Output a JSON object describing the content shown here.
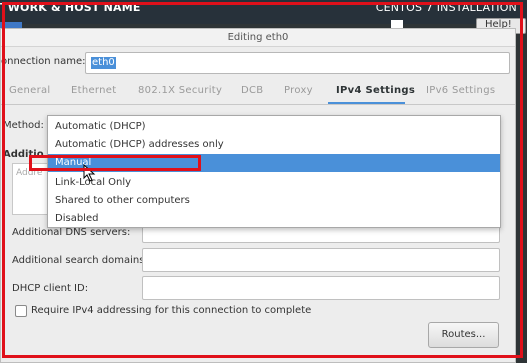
{
  "topbar": {
    "title": "TWORK & HOST NAME",
    "installer": "CENTOS 7 INSTALLATION",
    "help_label": "Help!"
  },
  "dialog": {
    "title": "Editing eth0",
    "connection_name_label": "onnection name:",
    "connection_name_value": "eth0"
  },
  "tabs": [
    {
      "label": "General",
      "active": false
    },
    {
      "label": "Ethernet",
      "active": false
    },
    {
      "label": "802.1X Security",
      "active": false
    },
    {
      "label": "DCB",
      "active": false
    },
    {
      "label": "Proxy",
      "active": false
    },
    {
      "label": "IPv4 Settings",
      "active": true
    },
    {
      "label": "IPv6 Settings",
      "active": false
    }
  ],
  "method": {
    "label": "Method:",
    "options": [
      "Automatic (DHCP)",
      "Automatic (DHCP) addresses only",
      "Manual",
      "Link-Local Only",
      "Shared to other computers",
      "Disabled"
    ],
    "highlighted_index": 2
  },
  "addresses": {
    "section_label": "Additio",
    "column_header": "Addre"
  },
  "fields": {
    "dns_label": "Additional DNS servers:",
    "search_label": "Additional search domains:",
    "dhcp_label": "DHCP client ID:"
  },
  "require_label": "Require IPv4 addressing for this connection to complete",
  "routes_label": "Routes...",
  "colors": {
    "highlight": "#4a90d9",
    "annotation": "#e0101a"
  }
}
